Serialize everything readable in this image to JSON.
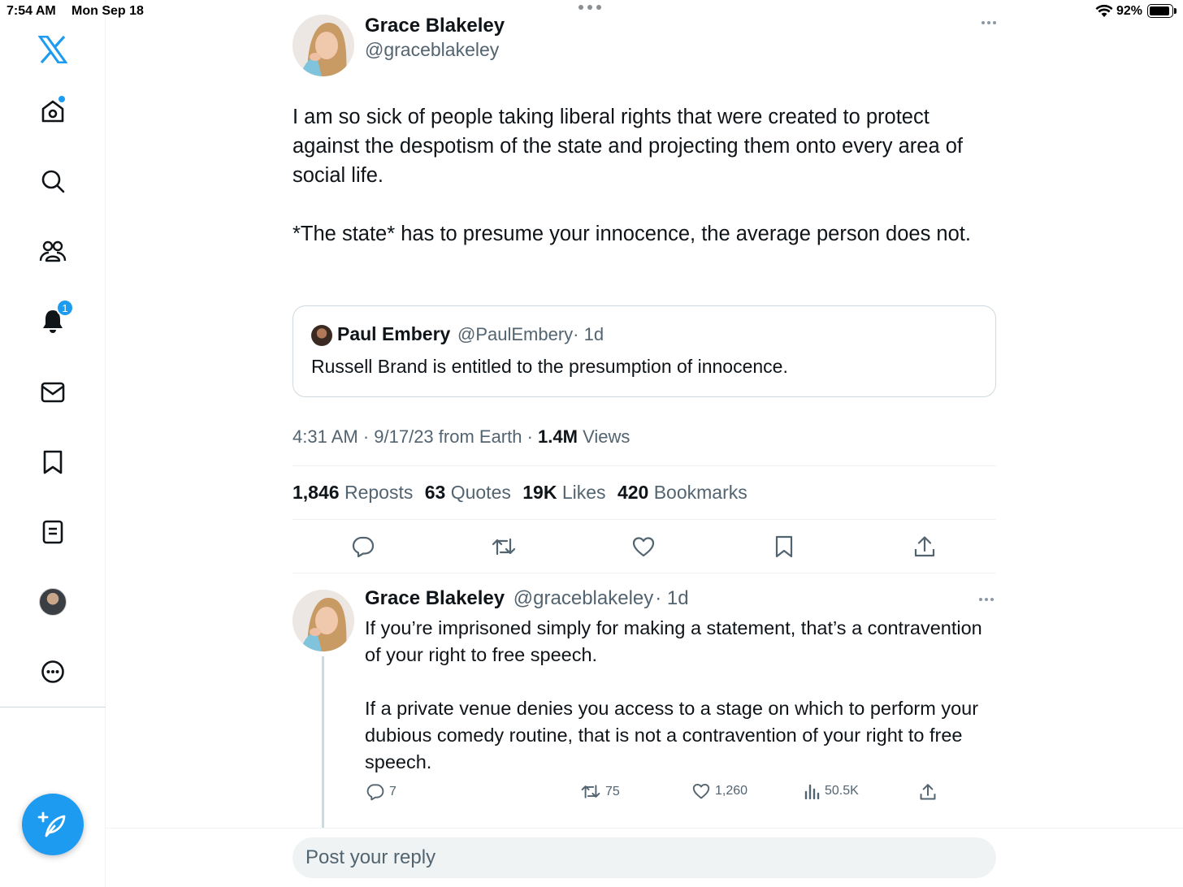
{
  "status_bar": {
    "time": "7:54 AM",
    "date": "Mon Sep 18",
    "battery": "92%",
    "battery_level": 0.92
  },
  "sidebar": {
    "items": [
      {
        "name": "x-logo",
        "icon": "x-logo"
      },
      {
        "name": "home",
        "icon": "home-icon",
        "has_dot": true
      },
      {
        "name": "explore",
        "icon": "search-icon"
      },
      {
        "name": "communities",
        "icon": "communities-icon"
      },
      {
        "name": "notifications",
        "icon": "bell-icon",
        "badge": "1"
      },
      {
        "name": "messages",
        "icon": "mail-icon"
      },
      {
        "name": "bookmarks",
        "icon": "bookmark-icon"
      },
      {
        "name": "lists",
        "icon": "list-icon"
      },
      {
        "name": "profile",
        "icon": "avatar"
      },
      {
        "name": "more",
        "icon": "more-circle-icon"
      }
    ],
    "compose_icon": "compose-feather-icon",
    "accent": "#1d9bf0"
  },
  "tweet": {
    "author_name": "Grace Blakeley",
    "author_handle": "@graceblakeley",
    "paragraphs": [
      "I am so sick of people taking liberal rights that were created to protect against the despotism of the state and projecting them onto every area of social life.",
      "*The state* has to presume your innocence, the average person does not."
    ],
    "quote": {
      "name": "Paul Embery",
      "handle": "@PaulEmbery",
      "time": "· 1d",
      "text": "Russell Brand is entitled to the presumption of innocence."
    },
    "meta": {
      "time": "4:31 AM · 9/17/23 from Earth ·",
      "views_count": "1.4M",
      "views_label": "Views"
    },
    "stats": {
      "reposts_count": "1,846",
      "reposts_label": "Reposts",
      "quotes_count": "63",
      "quotes_label": "Quotes",
      "likes_count": "19K",
      "likes_label": "Likes",
      "bookmarks_count": "420",
      "bookmarks_label": "Bookmarks"
    }
  },
  "reply": {
    "author_name": "Grace Blakeley",
    "author_handle": "@graceblakeley",
    "time": "· 1d",
    "paragraphs": [
      "If you’re imprisoned simply for making a statement, that’s a contravention of your right to free speech.",
      "If a private venue denies you access to a stage on which to perform your dubious comedy routine, that is not a contravention of your right to free speech."
    ],
    "replies": "7",
    "reposts": "75",
    "likes": "1,260",
    "views": "50.5K"
  },
  "reply_box": {
    "placeholder": "Post your reply"
  }
}
